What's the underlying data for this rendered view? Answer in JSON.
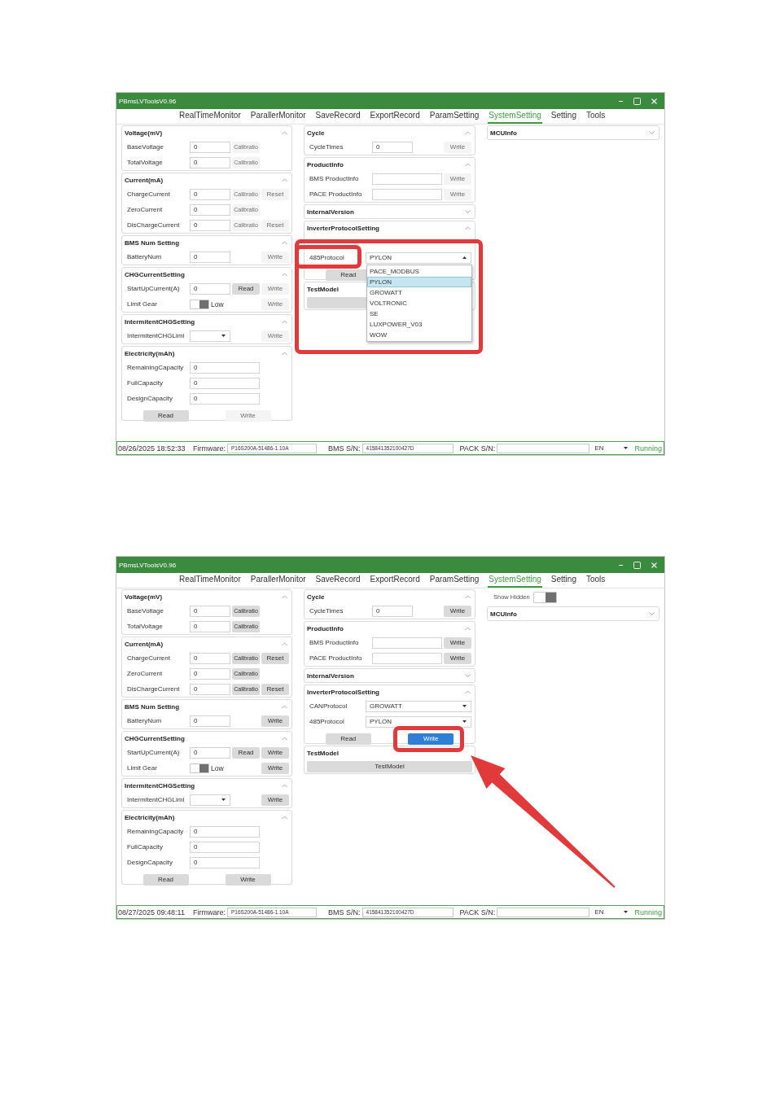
{
  "windows": [
    {
      "title": "PBmsLVToolsV0.96",
      "tabs": [
        {
          "label": "RealTimeMonitor",
          "selected": false
        },
        {
          "label": "ParallerMonitor",
          "selected": false
        },
        {
          "label": "SaveRecord",
          "selected": false
        },
        {
          "label": "ExportRecord",
          "selected": false
        },
        {
          "label": "ParamSetting",
          "selected": false
        },
        {
          "label": "SystemSetting",
          "selected": true
        },
        {
          "label": "Setting",
          "selected": false
        },
        {
          "label": "Tools",
          "selected": false
        }
      ],
      "left_panels": [
        {
          "title": "Voltage(mV)",
          "expanded": true,
          "rows": [
            {
              "kind": "field",
              "label": "BaseVoltage",
              "value": "0",
              "buttons": [
                {
                  "kind": "calibration",
                  "label": "Calibratio",
                  "disabled": true
                }
              ]
            },
            {
              "kind": "field",
              "label": "TotalVoltage",
              "value": "0",
              "buttons": [
                {
                  "kind": "calibration",
                  "label": "Calibratio",
                  "disabled": true
                }
              ]
            }
          ]
        },
        {
          "title": "Current(mA)",
          "expanded": true,
          "rows": [
            {
              "kind": "field",
              "label": "ChargeCurrent",
              "value": "0",
              "buttons": [
                {
                  "kind": "calibration",
                  "label": "Calibratio",
                  "disabled": true
                },
                {
                  "kind": "reset",
                  "label": "Reset",
                  "disabled": true
                }
              ]
            },
            {
              "kind": "field",
              "label": "ZeroCurrent",
              "value": "0",
              "buttons": [
                {
                  "kind": "calibration",
                  "label": "Calibratio",
                  "disabled": true
                }
              ]
            },
            {
              "kind": "field",
              "label": "DisChargeCurrent",
              "value": "0",
              "buttons": [
                {
                  "kind": "calibration",
                  "label": "Calibratio",
                  "disabled": true
                },
                {
                  "kind": "reset",
                  "label": "Reset",
                  "disabled": true
                }
              ]
            }
          ]
        },
        {
          "title": "BMS Num Setting",
          "expanded": true,
          "rows": [
            {
              "kind": "field",
              "label": "BatteryNum",
              "value": "0",
              "buttons": [
                {
                  "kind": "write",
                  "label": "Write",
                  "disabled": true
                }
              ]
            }
          ]
        },
        {
          "title": "CHGCurrentSetting",
          "expanded": true,
          "rows": [
            {
              "kind": "field",
              "label": "StartUpCurrent(A)",
              "value": "0",
              "buttons": [
                {
                  "kind": "read",
                  "label": "Read",
                  "disabled": false
                },
                {
                  "kind": "write",
                  "label": "Write",
                  "disabled": true
                }
              ]
            },
            {
              "kind": "toggle",
              "label": "Limit Gear",
              "on": true,
              "text": "Low",
              "buttons": [
                {
                  "kind": "write",
                  "label": "Write",
                  "disabled": true
                }
              ]
            }
          ]
        },
        {
          "title": "IntermitentCHGSetting",
          "expanded": true,
          "rows": [
            {
              "kind": "select",
              "label": "IntermitentCHGLimi",
              "expanded": false,
              "marked": false,
              "buttons": [
                {
                  "kind": "write",
                  "label": "Write",
                  "disabled": true
                }
              ]
            }
          ]
        },
        {
          "title": "Electricity(mAh)",
          "expanded": true,
          "rows": [
            {
              "kind": "wide_field",
              "label": "RemainingCapacity",
              "value": "0"
            },
            {
              "kind": "wide_field",
              "label": "FullCapacity",
              "value": "0"
            },
            {
              "kind": "wide_field",
              "label": "DesignCapacity",
              "value": "0"
            },
            {
              "kind": "actions",
              "buttons": [
                {
                  "kind": "read",
                  "label": "Read",
                  "disabled": false,
                  "highlighted": false,
                  "marked": false
                },
                {
                  "kind": "write",
                  "label": "Write",
                  "disabled": true,
                  "highlighted": false,
                  "marked": false
                }
              ]
            }
          ]
        }
      ],
      "middle_panels": [
        {
          "title": "Cycle",
          "expanded": true,
          "marked": false,
          "rows": [
            {
              "kind": "field",
              "label": "CycleTimes",
              "value": "0",
              "buttons": [
                {
                  "kind": "write",
                  "label": "Write",
                  "disabled": true
                }
              ]
            }
          ]
        },
        {
          "title": "ProductInfo",
          "expanded": true,
          "marked": false,
          "rows": [
            {
              "kind": "wide_field",
              "label": "BMS ProductInfo",
              "buttons": [
                {
                  "kind": "write",
                  "label": "Write",
                  "disabled": true
                }
              ]
            },
            {
              "kind": "wide_field",
              "label": "PACE ProductInfo",
              "buttons": [
                {
                  "kind": "write",
                  "label": "Write",
                  "disabled": true
                }
              ]
            }
          ]
        },
        {
          "title": "InternalVersion",
          "expanded": false,
          "marked": false
        },
        {
          "title": "InverterProtocolSetting",
          "expanded": true,
          "marked": true,
          "rows": [
            {
              "kind": "wide_select",
              "label": "485Protocol",
              "value": "PYLON",
              "expanded": true,
              "marked": true,
              "options": [
                {
                  "label": "PACE_MODBUS",
                  "selected": false
                },
                {
                  "label": "PYLON",
                  "selected": true
                },
                {
                  "label": "GROWATT",
                  "selected": false
                },
                {
                  "label": "VOLTRONIC",
                  "selected": false
                },
                {
                  "label": "SE",
                  "selected": false
                },
                {
                  "label": "LUXPOWER_V03",
                  "selected": false
                },
                {
                  "label": "WOW",
                  "selected": false
                }
              ]
            },
            {
              "kind": "actions",
              "buttons": [
                {
                  "kind": "read",
                  "label": "Read",
                  "disabled": false,
                  "highlighted": false,
                  "marked": false
                }
              ]
            }
          ]
        },
        {
          "title": "TestModel",
          "marked": false,
          "rows": [
            {
              "kind": "full_button",
              "buttons": [
                {
                  "kind": "testmodel",
                  "disabled": false
                }
              ]
            }
          ]
        }
      ],
      "right_panels": [
        {
          "title": "MCUInfo",
          "expanded": false
        }
      ],
      "status_bar": {
        "time": "08/26/2025 18:52:33",
        "firmware_label": "Firmware:",
        "firmware": "P16S200A-51486-1.10A",
        "bms_sn_label": "BMS S/N:",
        "bms_sn": "415841352100427D",
        "pack_sn_label": "PACK S/N:",
        "language": "EN",
        "status": "Running"
      },
      "arrow": false
    },
    {
      "title": "PBmsLVToolsV0.96",
      "tabs": [
        {
          "label": "RealTimeMonitor",
          "selected": false
        },
        {
          "label": "ParallerMonitor",
          "selected": false
        },
        {
          "label": "SaveRecord",
          "selected": false
        },
        {
          "label": "ExportRecord",
          "selected": false
        },
        {
          "label": "ParamSetting",
          "selected": false
        },
        {
          "label": "SystemSetting",
          "selected": true
        },
        {
          "label": "Setting",
          "selected": false
        },
        {
          "label": "Tools",
          "selected": false
        }
      ],
      "left_panels": [
        {
          "title": "Voltage(mV)",
          "expanded": true,
          "rows": [
            {
              "kind": "field",
              "label": "BaseVoltage",
              "value": "0",
              "buttons": [
                {
                  "kind": "calibration",
                  "label": "Calibratio",
                  "disabled": false
                }
              ]
            },
            {
              "kind": "field",
              "label": "TotalVoltage",
              "value": "0",
              "buttons": [
                {
                  "kind": "calibration",
                  "label": "Calibratio",
                  "disabled": false
                }
              ]
            }
          ]
        },
        {
          "title": "Current(mA)",
          "expanded": true,
          "rows": [
            {
              "kind": "field",
              "label": "ChargeCurrent",
              "value": "0",
              "buttons": [
                {
                  "kind": "calibration",
                  "label": "Calibratio",
                  "disabled": false
                },
                {
                  "kind": "reset",
                  "label": "Reset",
                  "disabled": false
                }
              ]
            },
            {
              "kind": "field",
              "label": "ZeroCurrent",
              "value": "0",
              "buttons": [
                {
                  "kind": "calibration",
                  "label": "Calibratio",
                  "disabled": false
                }
              ]
            },
            {
              "kind": "field",
              "label": "DisChargeCurrent",
              "value": "0",
              "buttons": [
                {
                  "kind": "calibration",
                  "label": "Calibratio",
                  "disabled": false
                },
                {
                  "kind": "reset",
                  "label": "Reset",
                  "disabled": false
                }
              ]
            }
          ]
        },
        {
          "title": "BMS Num Setting",
          "expanded": true,
          "rows": [
            {
              "kind": "field",
              "label": "BatteryNum",
              "value": "0",
              "buttons": [
                {
                  "kind": "write",
                  "label": "Write",
                  "disabled": false
                }
              ]
            }
          ]
        },
        {
          "title": "CHGCurrentSetting",
          "expanded": true,
          "rows": [
            {
              "kind": "field",
              "label": "StartUpCurrent(A)",
              "value": "0",
              "buttons": [
                {
                  "kind": "read",
                  "label": "Read",
                  "disabled": false
                },
                {
                  "kind": "write",
                  "label": "Write",
                  "disabled": false
                }
              ]
            },
            {
              "kind": "toggle",
              "label": "Limit Gear",
              "on": true,
              "text": "Low",
              "buttons": [
                {
                  "kind": "write",
                  "label": "Write",
                  "disabled": false
                }
              ]
            }
          ]
        },
        {
          "title": "IntermitentCHGSetting",
          "expanded": true,
          "rows": [
            {
              "kind": "select",
              "label": "IntermitentCHGLimi",
              "expanded": false,
              "marked": false,
              "buttons": [
                {
                  "kind": "write",
                  "label": "Write",
                  "disabled": false
                }
              ]
            }
          ]
        },
        {
          "title": "Electricity(mAh)",
          "expanded": true,
          "rows": [
            {
              "kind": "wide_field",
              "label": "RemainingCapacity",
              "value": "0"
            },
            {
              "kind": "wide_field",
              "label": "FullCapacity",
              "value": "0"
            },
            {
              "kind": "wide_field",
              "label": "DesignCapacity",
              "value": "0"
            },
            {
              "kind": "actions",
              "buttons": [
                {
                  "kind": "read",
                  "label": "Read",
                  "disabled": false,
                  "highlighted": false,
                  "marked": false
                },
                {
                  "kind": "write",
                  "label": "Write",
                  "disabled": false,
                  "highlighted": false,
                  "marked": false
                }
              ]
            }
          ]
        }
      ],
      "middle_panels": [
        {
          "title": "Cycle",
          "expanded": true,
          "marked": false,
          "rows": [
            {
              "kind": "field",
              "label": "CycleTimes",
              "value": "0",
              "buttons": [
                {
                  "kind": "write",
                  "label": "Write",
                  "disabled": false
                }
              ]
            }
          ]
        },
        {
          "title": "ProductInfo",
          "expanded": true,
          "marked": false,
          "rows": [
            {
              "kind": "wide_field",
              "label": "BMS ProductInfo",
              "buttons": [
                {
                  "kind": "write",
                  "label": "Write",
                  "disabled": false
                }
              ]
            },
            {
              "kind": "wide_field",
              "label": "PACE ProductInfo",
              "buttons": [
                {
                  "kind": "write",
                  "label": "Write",
                  "disabled": false
                }
              ]
            }
          ]
        },
        {
          "title": "InternalVersion",
          "expanded": false,
          "marked": false
        },
        {
          "title": "InverterProtocolSetting",
          "expanded": true,
          "marked": false,
          "rows": [
            {
              "kind": "wide_select",
              "label": "CANProtocol",
              "value": "GROWATT",
              "expanded": false,
              "marked": false
            },
            {
              "kind": "wide_select",
              "label": "485Protocol",
              "value": "PYLON",
              "expanded": false,
              "marked": false
            },
            {
              "kind": "actions",
              "buttons": [
                {
                  "kind": "read",
                  "label": "Read",
                  "disabled": false,
                  "highlighted": false,
                  "marked": false
                },
                {
                  "kind": "write",
                  "label": "Write",
                  "disabled": false,
                  "highlighted": true,
                  "marked": true
                }
              ]
            }
          ]
        },
        {
          "title": "TestModel",
          "marked": false,
          "rows": [
            {
              "kind": "full_button",
              "buttons": [
                {
                  "kind": "testmodel",
                  "label": "TestModel",
                  "disabled": false
                }
              ]
            }
          ]
        }
      ],
      "show_hidden": {
        "label": "Show Hidden",
        "on": true
      },
      "right_panels": [
        {
          "title": "MCUInfo",
          "expanded": false
        }
      ],
      "status_bar": {
        "time": "08/27/2025 09:48:11",
        "firmware_label": "Firmware:",
        "firmware": "P16S200A-51486-1.10A",
        "bms_sn_label": "BMS S/N:",
        "bms_sn": "415841352100427D",
        "pack_sn_label": "PACK S/N:",
        "language": "EN",
        "status": "Running"
      },
      "arrow": true
    }
  ]
}
